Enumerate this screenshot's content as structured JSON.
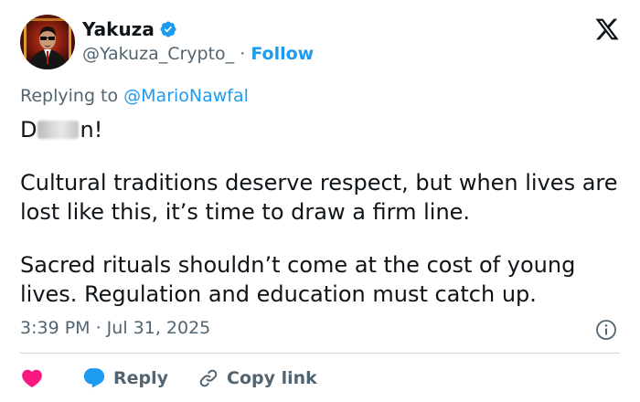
{
  "author": {
    "name": "Yakuza",
    "handle": "@Yakuza_Crypto_",
    "separator": "·",
    "follow_label": "Follow",
    "verified_icon": "verified-badge-icon"
  },
  "reply_context": {
    "prefix": "Replying to ",
    "mention": "@MarioNawfal"
  },
  "tweet": {
    "line1_start": "D",
    "line1_end": "n!",
    "paragraph2": "Cultural traditions deserve respect, but when lives are lost like this, it’s time to draw a firm line.",
    "paragraph3": "Sacred rituals shouldn’t come at the cost of young lives. Regulation and education must catch up."
  },
  "meta": {
    "timestamp": "3:39 PM · Jul 31, 2025"
  },
  "actions": {
    "reply_label": "Reply",
    "copy_link_label": "Copy link"
  },
  "colors": {
    "accent": "#1d9bf0",
    "heart": "#f91880",
    "secondary_text": "#536471",
    "text": "#0f1419",
    "divider": "#cfd9de"
  }
}
